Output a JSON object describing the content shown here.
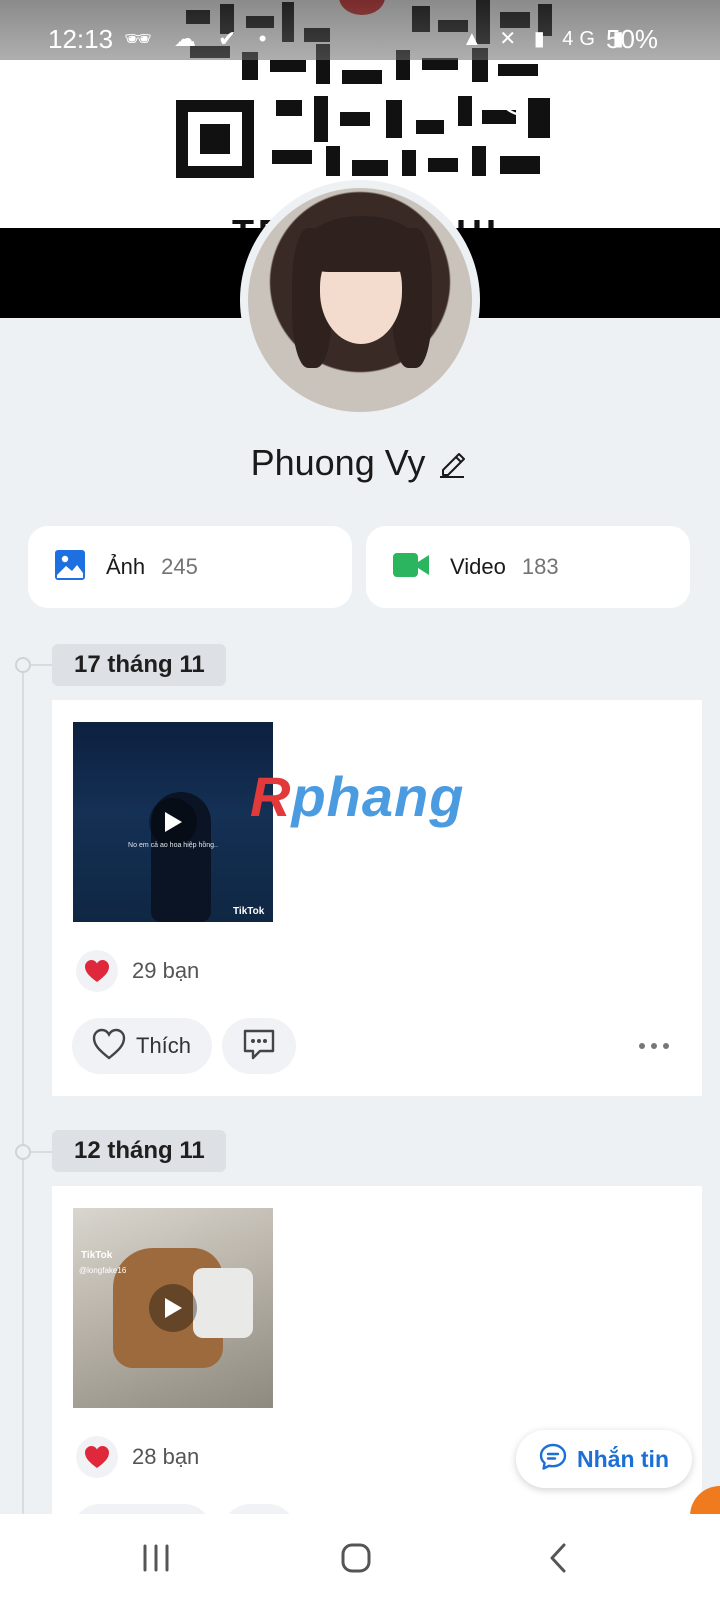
{
  "status_bar": {
    "time": "12:13",
    "left_icons": "🕶 ☁ ✔ •",
    "right_icons": "▲ ✕ ▮ 4G ▮",
    "battery": "50%"
  },
  "cover": {
    "title_partial": "TRUONG CHI"
  },
  "profile": {
    "name": "Phuong Vy"
  },
  "media": {
    "photos_label": "Ảnh",
    "photos_count": "245",
    "videos_label": "Video",
    "videos_count": "183"
  },
  "posts": [
    {
      "date": "17 tháng 11",
      "thumb_caption": "No em cả ao hoa hiệp hồng..",
      "tiktok_label": "TikTok",
      "likes": "29 bạn",
      "like_label": "Thích"
    },
    {
      "date": "12 tháng 11",
      "tiktok_label": "TikTok",
      "thumb_user": "@longfake16",
      "likes": "28 bạn"
    }
  ],
  "watermark": {
    "first": "R",
    "rest": "phang"
  },
  "message_button": {
    "label": "Nhắn tin"
  },
  "colors": {
    "accent": "#1b6fd6",
    "video_green": "#2cb55f",
    "photo_blue": "#1e6fe0",
    "heart_red": "#e0283c",
    "background": "#eef1f4"
  }
}
